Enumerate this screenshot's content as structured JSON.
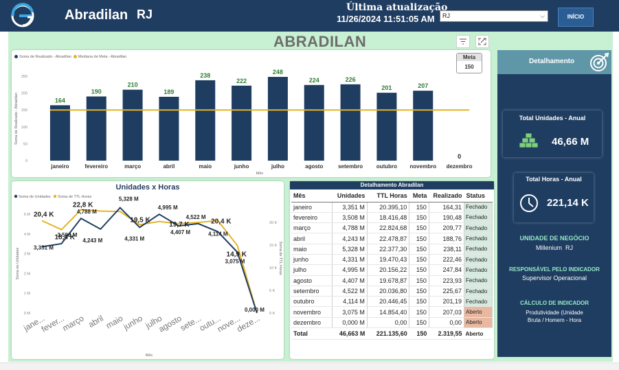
{
  "header": {
    "company": "Abradilan",
    "state": "RJ",
    "update_label": "Última atualização",
    "update_time": "11/26/2024 11:51:05 AM",
    "state_select_value": "RJ",
    "home_button": "INÍCIO"
  },
  "page_title": "ABRADILAN",
  "bar_chart": {
    "legend_realizado": "Soma de Realizado - Abradilan",
    "legend_meta": "Mediana de Meta - Abradilan",
    "ylabel": "Soma de Realizado - Abradilan",
    "xlabel": "Mês",
    "meta_label": "Meta",
    "meta_value": "150",
    "colors": {
      "bar": "#1f3d61",
      "meta_line": "#e5b325",
      "data_label": "#2e7d32"
    }
  },
  "line_chart": {
    "title": "Unidades x Horas",
    "legend_unidades": "Soma de Unidades",
    "legend_horas": "Soma de TTL Horas",
    "ylabel_left": "Soma de Unidades",
    "ylabel_right": "Soma de TTL Horas",
    "xlabel": "Mês",
    "colors": {
      "unidades": "#1f3d61",
      "horas": "#e5b325"
    }
  },
  "table": {
    "title": "Detalhamento Abradilan",
    "headers": [
      "Mês",
      "Unidades",
      "TTL Horas",
      "Meta",
      "Realizado",
      "Status"
    ],
    "rows": [
      [
        "janeiro",
        "3,351 M",
        "20.395,10",
        "150",
        "164,31",
        "Fechado"
      ],
      [
        "fevereiro",
        "3,508 M",
        "18.416,48",
        "150",
        "190,48",
        "Fechado"
      ],
      [
        "março",
        "4,788 M",
        "22.824,68",
        "150",
        "209,77",
        "Fechado"
      ],
      [
        "abril",
        "4,243 M",
        "22.478,87",
        "150",
        "188,76",
        "Fechado"
      ],
      [
        "maio",
        "5,328 M",
        "22.377,30",
        "150",
        "238,11",
        "Fechado"
      ],
      [
        "junho",
        "4,331 M",
        "19.470,43",
        "150",
        "222,46",
        "Fechado"
      ],
      [
        "julho",
        "4,995 M",
        "20.156,22",
        "150",
        "247,84",
        "Fechado"
      ],
      [
        "agosto",
        "4,407 M",
        "19.678,87",
        "150",
        "223,93",
        "Fechado"
      ],
      [
        "setembro",
        "4,522 M",
        "20.036,80",
        "150",
        "225,67",
        "Fechado"
      ],
      [
        "outubro",
        "4,114 M",
        "20.446,45",
        "150",
        "201,19",
        "Fechado"
      ],
      [
        "novembro",
        "3,075 M",
        "14.854,40",
        "150",
        "207,03",
        "Aberto"
      ],
      [
        "dezembro",
        "0,000 M",
        "0,00",
        "150",
        "0,00",
        "Aberto"
      ]
    ],
    "total": [
      "Total",
      "46,663 M",
      "221.135,60",
      "150",
      "2.319,55",
      "Aberto"
    ]
  },
  "right_panel": {
    "header": "Detalhamento",
    "kpi_unidades_title": "Total Unidades - Anual",
    "kpi_unidades_value": "46,66 M",
    "kpi_horas_title": "Total Horas - Anual",
    "kpi_horas_value": "221,14 K",
    "unidade_title": "UNIDADE DE NEGÓCIO",
    "unidade_value": "Millenium",
    "unidade_state": "RJ",
    "responsavel_title": "RESPONSÁVEL PELO INDICADOR",
    "responsavel_value": "Supervisor Operacional",
    "calculo_title": "CÁLCULO DE INDICADOR",
    "calculo_line1": "Produtividade (Unidade",
    "calculo_line2": "Bruta / Homem - Hora"
  },
  "chart_data": [
    {
      "type": "bar",
      "categories": [
        "janeiro",
        "fevereiro",
        "março",
        "abril",
        "maio",
        "junho",
        "julho",
        "agosto",
        "setembro",
        "outubro",
        "novembro",
        "dezembro"
      ],
      "series": [
        {
          "name": "Soma de Realizado - Abradilan",
          "values": [
            164,
            190,
            210,
            189,
            238,
            222,
            248,
            224,
            226,
            201,
            207,
            0
          ]
        },
        {
          "name": "Mediana de Meta - Abradilan",
          "values": [
            150,
            150,
            150,
            150,
            150,
            150,
            150,
            150,
            150,
            150,
            150,
            150
          ]
        }
      ],
      "xlabel": "Mês",
      "ylabel": "Soma de Realizado - Abradilan",
      "ylim": [
        0,
        250
      ],
      "yticks": [
        0,
        50,
        100,
        150,
        200,
        250
      ]
    },
    {
      "type": "line",
      "title": "Unidades x Horas",
      "categories": [
        "jane...",
        "fever...",
        "março",
        "abril",
        "maio",
        "junho",
        "julho",
        "agosto",
        "sete...",
        "outu...",
        "nove...",
        "deze..."
      ],
      "series": [
        {
          "name": "Soma de Unidades",
          "axis": "left",
          "values": [
            3.351,
            3.508,
            4.788,
            4.243,
            5.328,
            4.331,
            4.995,
            4.407,
            4.522,
            4.114,
            3.075,
            0.0
          ],
          "labels": [
            "3,351 M",
            "3,508 M",
            "4,788 M",
            "4,243 M",
            "5,328 M",
            "4,331 M",
            "4,995 M",
            "4,407 M",
            "4,522 M",
            "4,114 M",
            "3,075 M",
            "0,000 M"
          ]
        },
        {
          "name": "Soma de TTL Horas",
          "axis": "right",
          "values": [
            20.4,
            18.4,
            22.8,
            22.5,
            22.4,
            19.5,
            20.2,
            19.7,
            20.0,
            20.4,
            14.9,
            0.0
          ],
          "labels": [
            "20,4 K",
            "18,4 K",
            "22,8 K",
            "",
            "",
            "19,5 K",
            "",
            "19,7 K",
            "",
            "20,4 K",
            "14,9 K",
            ""
          ]
        }
      ],
      "xlabel": "Mês",
      "ylabel_left": "Soma de Unidades",
      "ylabel_right": "Soma de TTL Horas",
      "ylim_left": [
        0,
        5
      ],
      "yticks_left": [
        "0 M",
        "1 M",
        "2 M",
        "3 M",
        "4 M",
        "5 M"
      ],
      "ylim_right": [
        0,
        20
      ],
      "yticks_right": [
        "0 K",
        "5 K",
        "10 K",
        "15 K",
        "20 K"
      ]
    }
  ]
}
